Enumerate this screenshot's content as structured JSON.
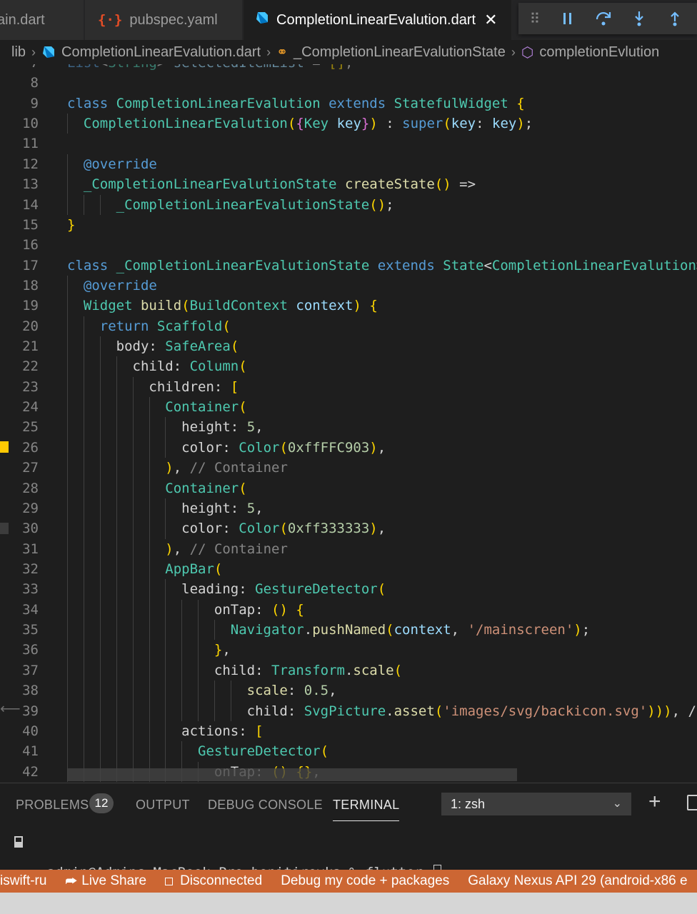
{
  "tabs": [
    {
      "label": "ain.dart",
      "icon": "dart-icon",
      "active": false
    },
    {
      "label": "pubspec.yaml",
      "icon": "yaml-braces-icon",
      "active": false
    },
    {
      "label": "CompletionLinearEvalution.dart",
      "icon": "dart-icon",
      "active": true
    }
  ],
  "debug_toolbar": [
    "drag-grip-icon",
    "pause-icon",
    "step-over-icon",
    "step-into-icon",
    "step-out-icon"
  ],
  "breadcrumb": {
    "folder": "lib",
    "file": "CompletionLinearEvalution.dart",
    "class": "_CompletionLinearEvalutionState",
    "member": "completionEvlution"
  },
  "editor": {
    "lines": [
      {
        "n": "7",
        "code": "List<String> selectedItemList = [];"
      },
      {
        "n": "8",
        "code": ""
      },
      {
        "n": "9",
        "code": "class CompletionLinearEvalution extends StatefulWidget {"
      },
      {
        "n": "10",
        "code": "  CompletionLinearEvalution({Key key}) : super(key: key);"
      },
      {
        "n": "11",
        "code": ""
      },
      {
        "n": "12",
        "code": "  @override"
      },
      {
        "n": "13",
        "code": "  _CompletionLinearEvalutionState createState() =>"
      },
      {
        "n": "14",
        "code": "      _CompletionLinearEvalutionState();"
      },
      {
        "n": "15",
        "code": "}"
      },
      {
        "n": "16",
        "code": ""
      },
      {
        "n": "17",
        "code": "class _CompletionLinearEvalutionState extends State<CompletionLinearEvalution>"
      },
      {
        "n": "18",
        "code": "  @override"
      },
      {
        "n": "19",
        "code": "  Widget build(BuildContext context) {"
      },
      {
        "n": "20",
        "code": "    return Scaffold("
      },
      {
        "n": "21",
        "code": "      body: SafeArea("
      },
      {
        "n": "22",
        "code": "        child: Column("
      },
      {
        "n": "23",
        "code": "          children: ["
      },
      {
        "n": "24",
        "code": "            Container("
      },
      {
        "n": "25",
        "code": "              height: 5,"
      },
      {
        "n": "26",
        "code": "              color: Color(0xffFFC903),"
      },
      {
        "n": "27",
        "code": "            ), // Container"
      },
      {
        "n": "28",
        "code": "            Container("
      },
      {
        "n": "29",
        "code": "              height: 5,"
      },
      {
        "n": "30",
        "code": "              color: Color(0xff333333),"
      },
      {
        "n": "31",
        "code": "            ), // Container"
      },
      {
        "n": "32",
        "code": "            AppBar("
      },
      {
        "n": "33",
        "code": "              leading: GestureDetector("
      },
      {
        "n": "34",
        "code": "                  onTap: () {"
      },
      {
        "n": "35",
        "code": "                    Navigator.pushNamed(context, '/mainscreen');"
      },
      {
        "n": "36",
        "code": "                  },"
      },
      {
        "n": "37",
        "code": "                  child: Transform.scale("
      },
      {
        "n": "38",
        "code": "                      scale: 0.5,"
      },
      {
        "n": "39",
        "code": "                      child: SvgPicture.asset('images/svg/backicon.svg'))), /"
      },
      {
        "n": "40",
        "code": "              actions: ["
      },
      {
        "n": "41",
        "code": "                GestureDetector("
      },
      {
        "n": "42",
        "code": "                  onTap: () {},"
      }
    ]
  },
  "panel": {
    "tabs": [
      "PROBLEMS",
      "OUTPUT",
      "DEBUG CONSOLE",
      "TERMINAL"
    ],
    "problems_count": "12",
    "active_tab": "TERMINAL",
    "terminal_select": "1: zsh",
    "terminal_prompt": "admin@Admins-MacBook-Pro bonitirovka % flutter "
  },
  "statusbar": {
    "branch": "iswift-ru",
    "live_share": "Live Share",
    "connection": "Disconnected",
    "debug_mode": "Debug my code + packages",
    "device": "Galaxy Nexus API 29 (android-x86 e"
  },
  "colors": {
    "editor_bg": "#1e1e1e",
    "statusbar_bg": "#cc6633",
    "gutter_mark_yellow": "#ffc903",
    "keyword": "#569cd6",
    "class": "#4ec9b0",
    "string": "#ce9178"
  }
}
